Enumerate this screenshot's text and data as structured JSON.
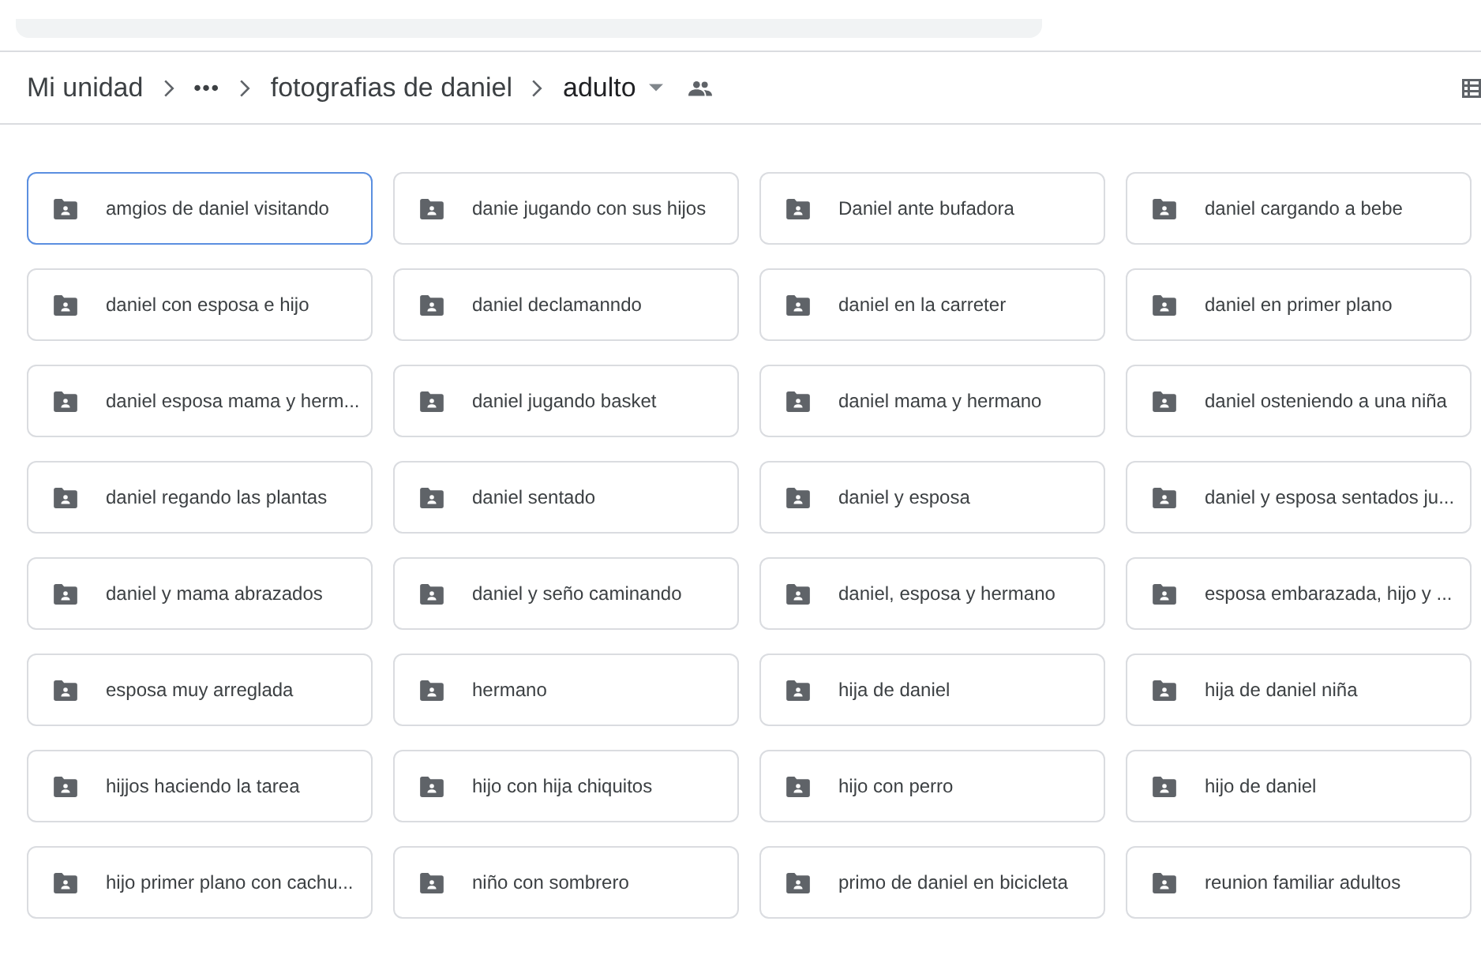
{
  "breadcrumb": [
    {
      "kind": "text",
      "label": "Mi unidad"
    },
    {
      "kind": "ellipsis",
      "label": "•••"
    },
    {
      "kind": "text",
      "label": "fotografias de daniel"
    },
    {
      "kind": "current",
      "label": "adulto"
    }
  ],
  "folders": [
    {
      "name": "amgios de daniel visitando",
      "selected": true
    },
    {
      "name": "danie jugando con sus hijos",
      "selected": false
    },
    {
      "name": "Daniel ante bufadora",
      "selected": false
    },
    {
      "name": "daniel cargando a bebe",
      "selected": false
    },
    {
      "name": "daniel con esposa e hijo",
      "selected": false
    },
    {
      "name": "daniel declamanndo",
      "selected": false
    },
    {
      "name": "daniel en la carreter",
      "selected": false
    },
    {
      "name": "daniel en primer plano",
      "selected": false
    },
    {
      "name": "daniel esposa mama y herm...",
      "selected": false
    },
    {
      "name": "daniel jugando basket",
      "selected": false
    },
    {
      "name": "daniel mama y hermano",
      "selected": false
    },
    {
      "name": "daniel osteniendo a una niña",
      "selected": false
    },
    {
      "name": "daniel regando las plantas",
      "selected": false
    },
    {
      "name": "daniel sentado",
      "selected": false
    },
    {
      "name": "daniel y esposa",
      "selected": false
    },
    {
      "name": "daniel y esposa sentados ju...",
      "selected": false
    },
    {
      "name": "daniel y mama abrazados",
      "selected": false
    },
    {
      "name": "daniel y seño caminando",
      "selected": false
    },
    {
      "name": "daniel, esposa y hermano",
      "selected": false
    },
    {
      "name": "esposa embarazada, hijo y ...",
      "selected": false
    },
    {
      "name": "esposa muy arreglada",
      "selected": false
    },
    {
      "name": "hermano",
      "selected": false
    },
    {
      "name": "hija de daniel",
      "selected": false
    },
    {
      "name": "hija de daniel niña",
      "selected": false
    },
    {
      "name": "hijjos haciendo la tarea",
      "selected": false
    },
    {
      "name": "hijo con hija chiquitos",
      "selected": false
    },
    {
      "name": "hijo con perro",
      "selected": false
    },
    {
      "name": "hijo de daniel",
      "selected": false
    },
    {
      "name": "hijo primer plano con cachu...",
      "selected": false
    },
    {
      "name": "niño con sombrero",
      "selected": false
    },
    {
      "name": "primo de daniel en bicicleta",
      "selected": false
    },
    {
      "name": "reunion familiar adultos",
      "selected": false
    }
  ]
}
